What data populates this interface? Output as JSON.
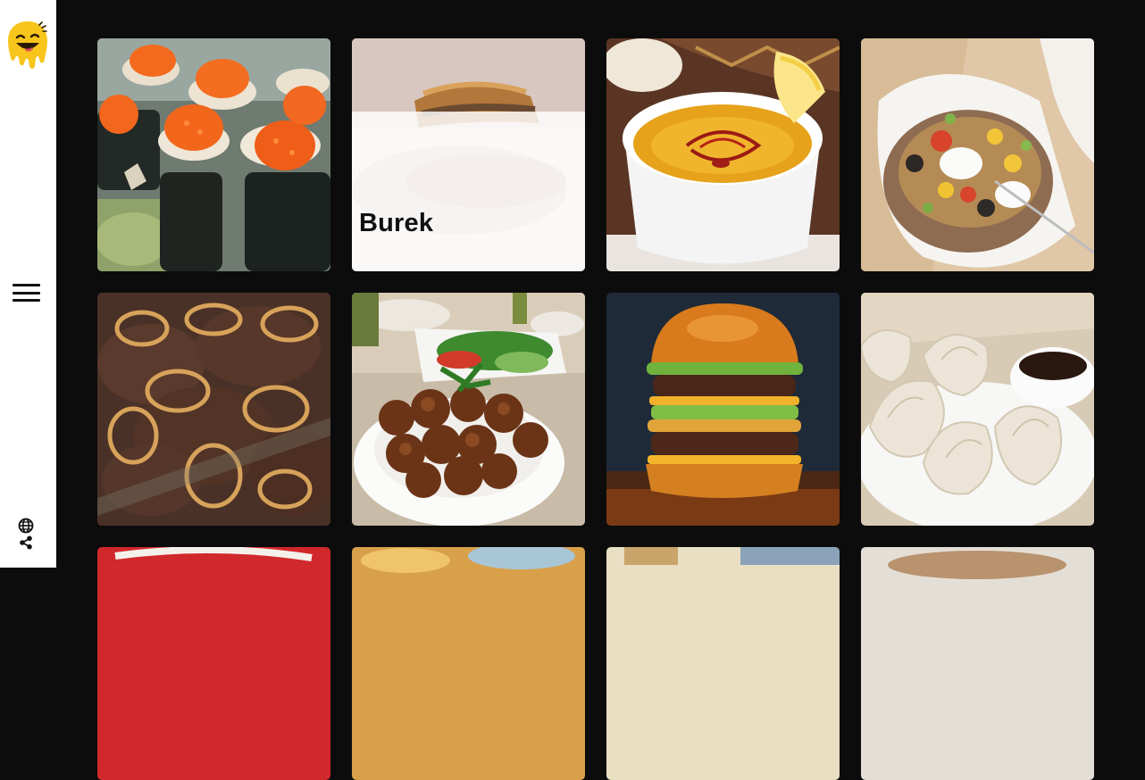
{
  "sidebar": {
    "logo": "smiley-drip-logo",
    "menu_icon": "hamburger-menu-icon",
    "language_icon": "globe-icon",
    "share_icon": "share-icon"
  },
  "colors": {
    "page_background": "#0c0c0c",
    "sidebar_background": "#ffffff",
    "logo_yellow": "#f7c51c"
  },
  "dishes": [
    {
      "name": "sushi-roe-rolls",
      "label": ""
    },
    {
      "name": "burek",
      "label": "Burek"
    },
    {
      "name": "lentil-soup",
      "label": ""
    },
    {
      "name": "stuffed-baked-potato",
      "label": ""
    },
    {
      "name": "liver-with-onions",
      "label": ""
    },
    {
      "name": "falafel",
      "label": ""
    },
    {
      "name": "double-cheeseburger",
      "label": ""
    },
    {
      "name": "dumplings",
      "label": ""
    },
    {
      "name": "dish-9",
      "label": ""
    },
    {
      "name": "dish-10",
      "label": ""
    },
    {
      "name": "dish-11",
      "label": ""
    },
    {
      "name": "dish-12",
      "label": ""
    }
  ]
}
